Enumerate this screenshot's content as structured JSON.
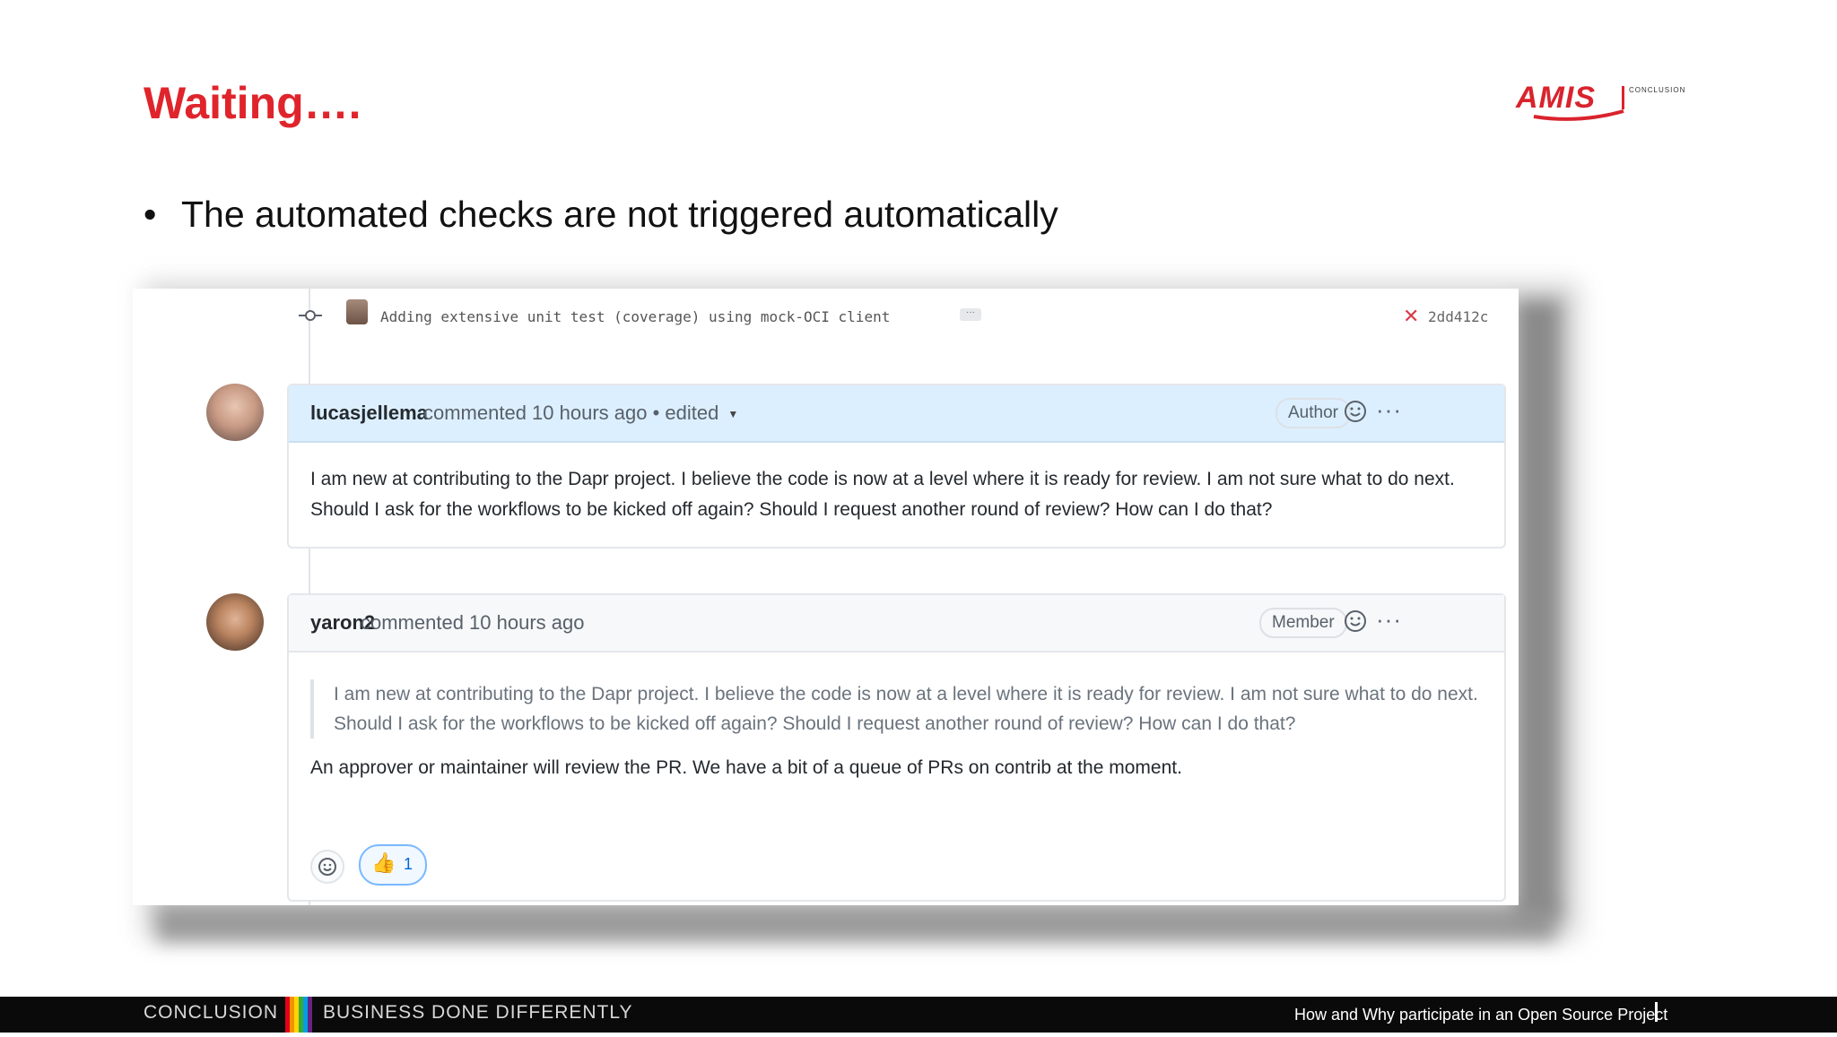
{
  "slide": {
    "title": "Waiting….",
    "bullet": "The automated checks are not triggered automatically"
  },
  "logo": {
    "word": "AMIS",
    "tagline": "CONCLUSION"
  },
  "commit": {
    "message": "Adding extensive unit test (coverage) using mock-OCI client",
    "more": "···",
    "status_icon": "x-fail-icon",
    "sha": "2dd412c"
  },
  "comments": [
    {
      "author": "lucasjellema",
      "meta": "commented 10 hours ago • edited",
      "role": "Author",
      "body": "I am new at contributing to the Dapr project. I believe the code is now at a level where it is ready for review. I am not sure what to do next. Should I ask for the workflows to be kicked off again? Should I request another round of review? How can I do that?"
    },
    {
      "author": "yaron2",
      "meta": "commented 10 hours ago",
      "role": "Member",
      "quote": "I am new at contributing to the Dapr project. I believe the code is now at a level where it is ready for review. I am not sure what to do next. Should I ask for the workflows to be kicked off again? Should I request another round of review? How can I do that?",
      "body": "An approver or maintainer will review the PR. We have a bit of a queue of PRs on contrib at the moment.",
      "reaction_count": "1"
    }
  ],
  "footer": {
    "left": "CONCLUSION",
    "middle": "BUSINESS DONE DIFFERENTLY",
    "right": "How and Why participate in an Open Source Project",
    "stripe_colors": [
      "#e2001a",
      "#f39200",
      "#ffd500",
      "#3aaa35",
      "#009fe3",
      "#662483"
    ]
  },
  "colors": {
    "title_red": "#e0242b",
    "highlight_header": "#dcefff"
  }
}
